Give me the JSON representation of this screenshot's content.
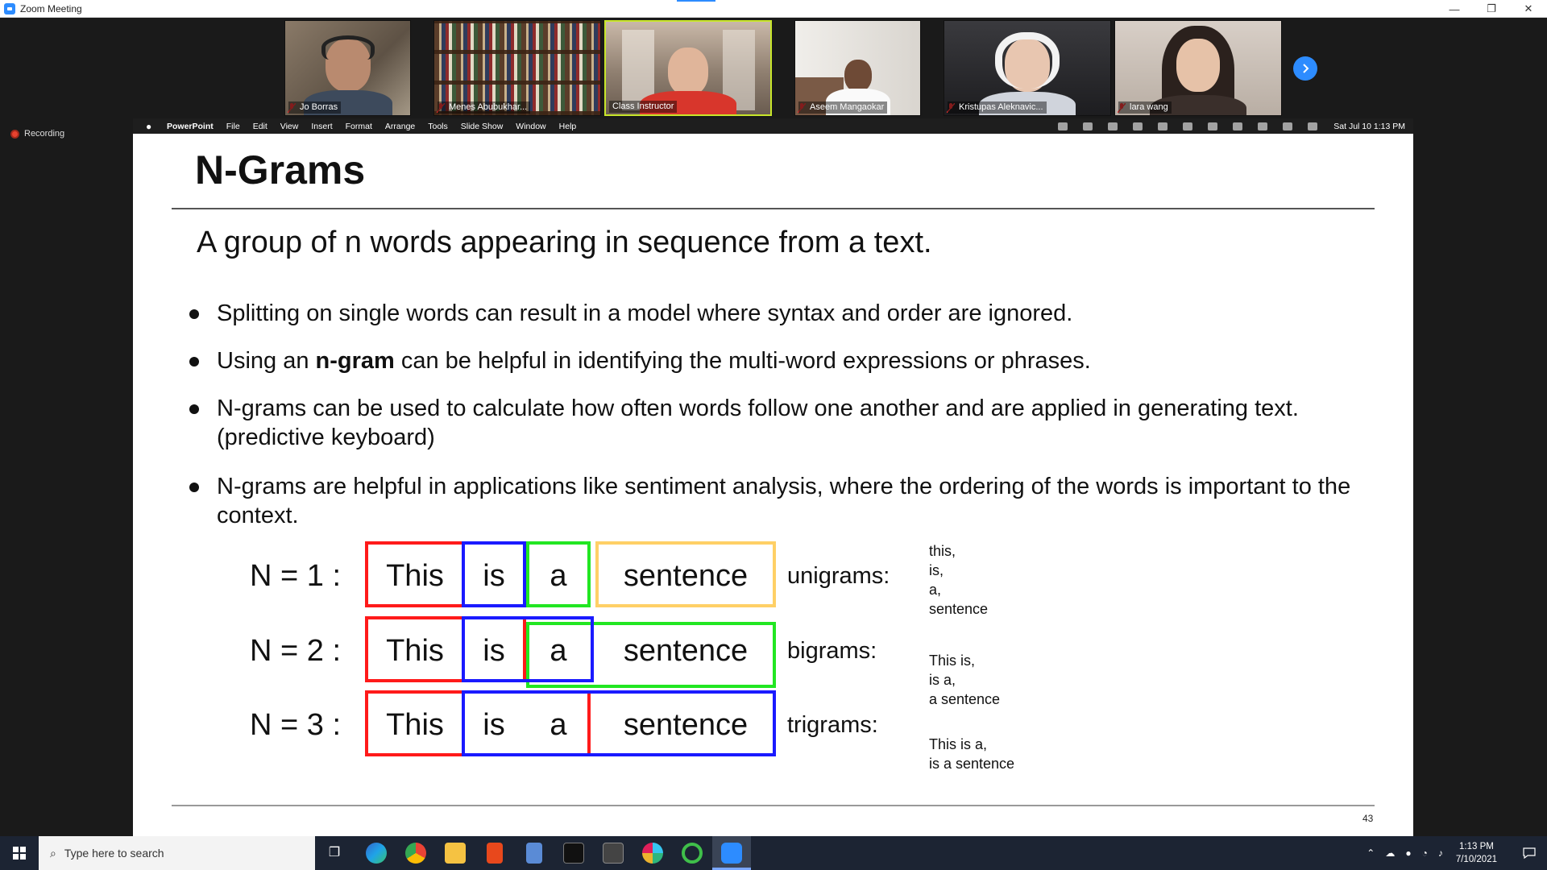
{
  "window": {
    "title": "Zoom Meeting",
    "controls": [
      "—",
      "❐",
      "✕"
    ]
  },
  "participants": [
    {
      "name": "Jo Borras",
      "muted": true
    },
    {
      "name": "Menes  Abubukhar...",
      "muted": true
    },
    {
      "name": "Class Instructor",
      "muted": false,
      "speaking": true
    },
    {
      "name": "Aseem Mangaokar",
      "muted": true
    },
    {
      "name": "Kristupas Aleknavic...",
      "muted": true
    },
    {
      "name": "lara wang",
      "muted": true
    }
  ],
  "recording": {
    "label": "Recording"
  },
  "mac_menubar": {
    "app": "PowerPoint",
    "menus": [
      "File",
      "Edit",
      "View",
      "Insert",
      "Format",
      "Arrange",
      "Tools",
      "Slide Show",
      "Window",
      "Help"
    ],
    "clock": "Sat Jul 10  1:13 PM"
  },
  "slide": {
    "title": "N-Grams",
    "subtitle": "A group of n words appearing in sequence from a text.",
    "bullets": [
      {
        "before": "Splitting on single words can result in a model where syntax and order are ignored.",
        "bold": "",
        "after": ""
      },
      {
        "before": "Using an ",
        "bold": "n-gram",
        "after": " can be helpful in identifying the multi-word expressions or phrases."
      },
      {
        "before": "N-grams can be used to calculate how often words follow one another and are applied in generating text. (predictive keyboard)",
        "bold": "",
        "after": ""
      },
      {
        "before": "N-grams are helpful in applications like sentiment analysis, where the ordering of the words is important to the context.",
        "bold": "",
        "after": ""
      }
    ],
    "ngram_rows": [
      {
        "label": "N = 1 :",
        "words": [
          "This",
          "is",
          "a",
          "sentence"
        ],
        "kind": "unigrams:",
        "grams": [
          "this,",
          "is,",
          "a,",
          "sentence"
        ]
      },
      {
        "label": "N = 2 :",
        "words": [
          "This",
          "is",
          "a",
          "sentence"
        ],
        "kind": "bigrams:",
        "grams": [
          "This is,",
          "is a,",
          "a sentence"
        ]
      },
      {
        "label": "N = 3 :",
        "words": [
          "This",
          "is",
          "a",
          "sentence"
        ],
        "kind": "trigrams:",
        "grams": [
          "This is a,",
          "is a sentence"
        ]
      }
    ],
    "page_number": "43",
    "colors": {
      "red": "#ff1a1a",
      "blue": "#1a1aff",
      "green": "#22e622",
      "yellow": "#ffd066"
    }
  },
  "taskbar": {
    "search_placeholder": "Type here to search",
    "time": "1:13 PM",
    "date": "7/10/2021"
  }
}
